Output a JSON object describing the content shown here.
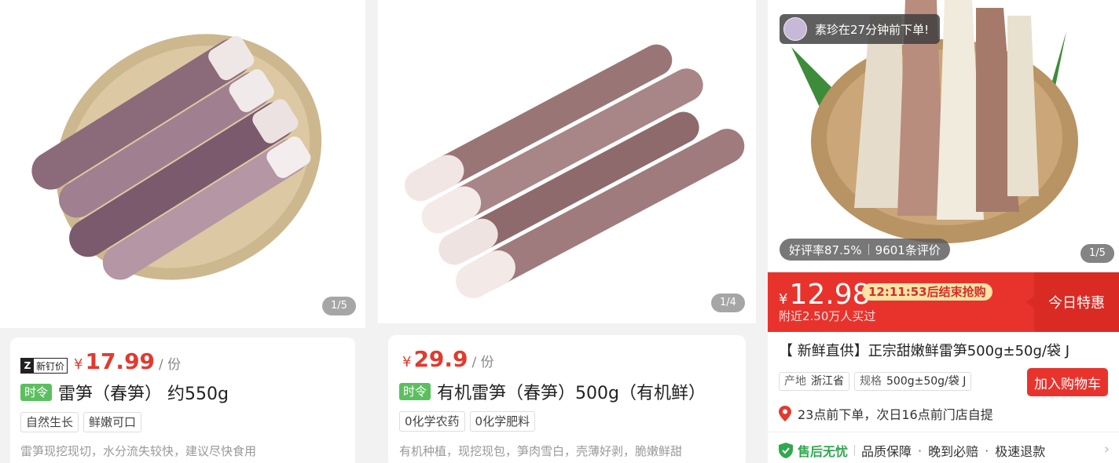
{
  "products": [
    {
      "counter": "1/5",
      "badge_label": "新钉价",
      "price_symbol": "¥",
      "price": "17.99",
      "unit": "/ 份",
      "season_tag": "时令",
      "title": "雷笋（春笋） 约550g",
      "tags": [
        "自然生长",
        "鲜嫩可口"
      ],
      "desc": "雷笋现挖现切，水分流失较快，建议尽快食用"
    },
    {
      "counter": "1/4",
      "price_symbol": "¥",
      "price": "29.9",
      "unit": "/ 份",
      "season_tag": "时令",
      "title": "有机雷笋（春笋）500g（有机鲜）",
      "tags": [
        "0化学农药",
        "0化学肥料"
      ],
      "desc": "有机种植，现挖现包，笋肉雪白，壳薄好剥，脆嫩鲜甜"
    }
  ],
  "detail": {
    "order_toast": "素珍在27分钟前下单!",
    "rating": "好评率87.5%",
    "reviews": "9601条评价",
    "counter": "1/5",
    "price_symbol": "¥",
    "price": "12.98",
    "countdown": "12:11:53后结束抢购",
    "nearby": "附近2.50万人买过",
    "today_label": "今日特惠",
    "title": "【 新鲜直供】正宗甜嫩鲜雷笋500g±50g/袋 J",
    "specs": [
      {
        "k": "产地",
        "v": "浙江省"
      },
      {
        "k": "规格",
        "v": "500g±50g/袋 J"
      }
    ],
    "cart_button": "加入购物车",
    "pickup": "23点前下单，次日16点前门店自提",
    "service_title": "售后无忧",
    "services": [
      "品质保障",
      "晚到必赔",
      "极速退款"
    ]
  },
  "colors": {
    "accent": "#e23a2e",
    "season": "#5cbf5f",
    "green_check": "#2fa84f"
  },
  "icons": [
    "location-pin-icon",
    "shield-check-icon",
    "chevron-right-icon"
  ]
}
